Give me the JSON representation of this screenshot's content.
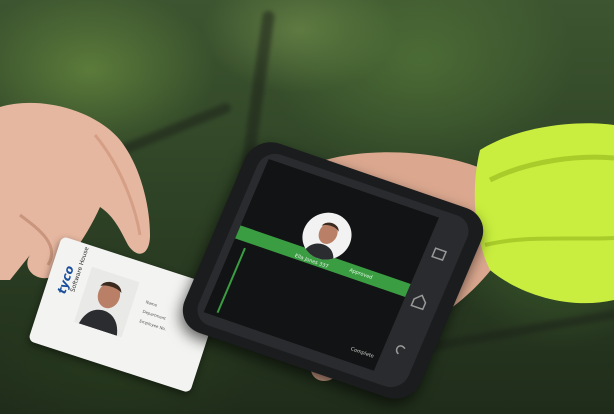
{
  "card": {
    "brand": "tyco",
    "title": "Software House",
    "fields": [
      "Name",
      "Department",
      "Employee No."
    ]
  },
  "phone": {
    "profile_name": "Ella Jones 337",
    "status": "Approved",
    "footer": "Complete"
  }
}
